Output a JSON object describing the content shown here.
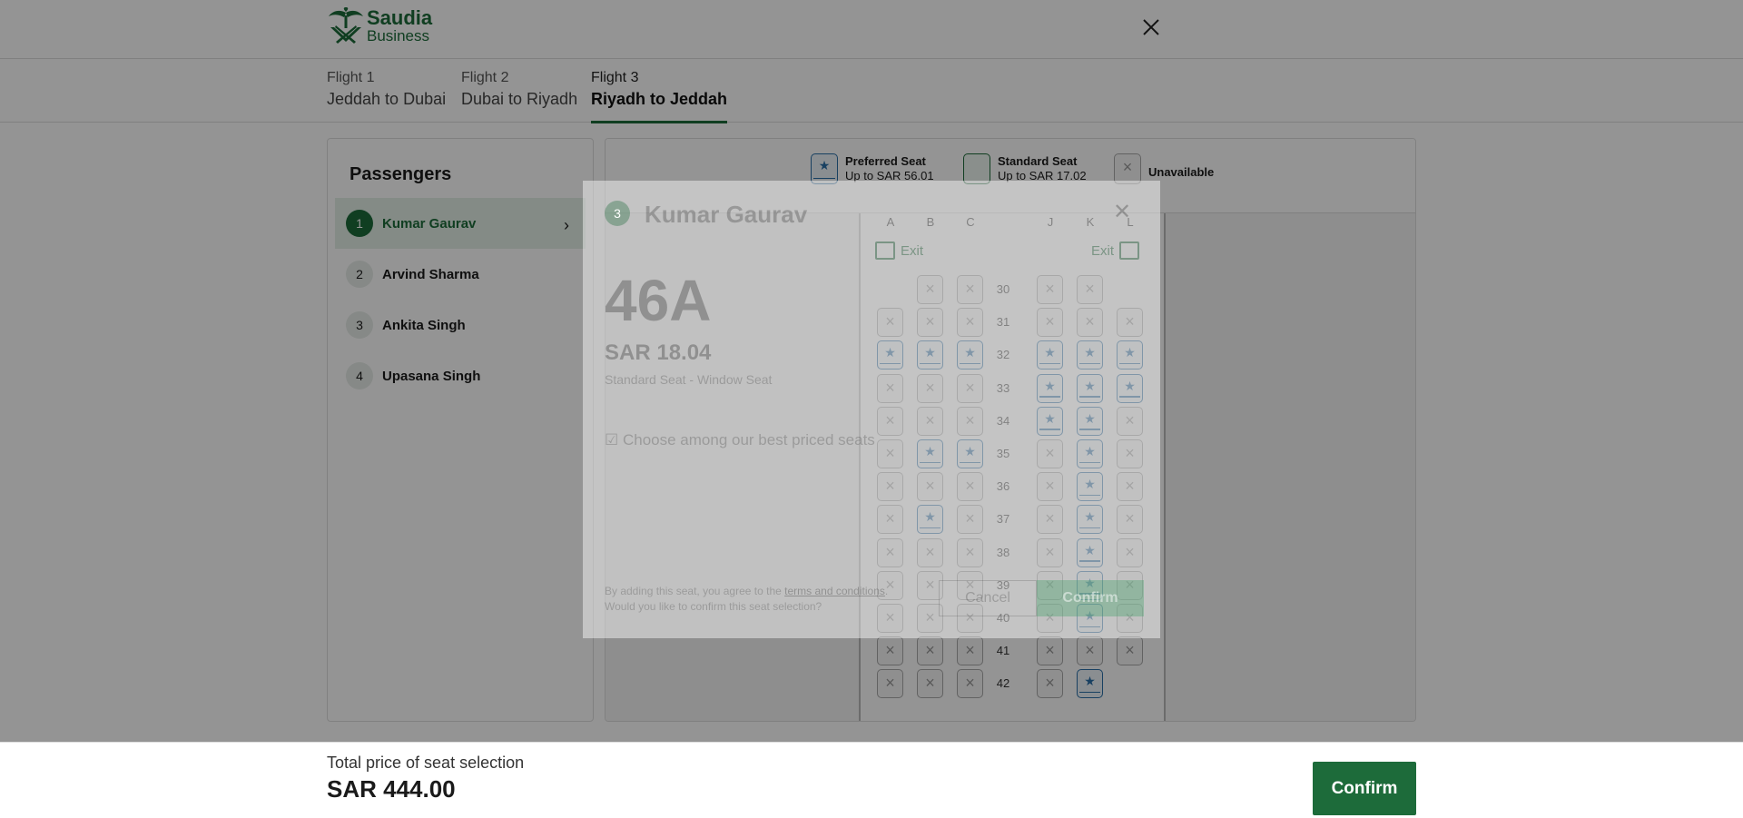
{
  "header": {
    "logo_line1": "Saudia",
    "logo_line2": "Business"
  },
  "tabs": [
    {
      "label": "Flight 1",
      "route": "Jeddah to Dubai"
    },
    {
      "label": "Flight 2",
      "route": "Dubai to Riyadh"
    },
    {
      "label": "Flight 3",
      "route": "Riyadh to Jeddah"
    }
  ],
  "passengers": {
    "title": "Passengers",
    "items": [
      {
        "num": "1",
        "name": "Kumar Gaurav"
      },
      {
        "num": "2",
        "name": "Arvind Sharma"
      },
      {
        "num": "3",
        "name": "Ankita Singh"
      },
      {
        "num": "4",
        "name": "Upasana Singh"
      }
    ]
  },
  "legend": {
    "preferred": {
      "title": "Preferred Seat",
      "price": "Up to SAR 56.01"
    },
    "standard": {
      "title": "Standard Seat",
      "price": "Up to SAR 17.02"
    },
    "unavailable": {
      "title": "Unavailable"
    }
  },
  "seat_map": {
    "columns": [
      "A",
      "B",
      "C",
      "J",
      "K",
      "L"
    ],
    "exit_label": "Exit",
    "rows": [
      "30",
      "31",
      "32",
      "33",
      "34",
      "35",
      "36",
      "37",
      "38",
      "39",
      "40",
      "41",
      "42"
    ]
  },
  "modal": {
    "num": "3",
    "name": "Kumar Gaurav",
    "seat": "46A",
    "price": "SAR 18.04",
    "type": "Standard Seat - Window Seat",
    "choose": "Choose among our best  priced seats",
    "terms_prefix": "By adding this seat, you agree to the ",
    "terms_link": "terms and conditions",
    "terms_suffix": ".",
    "terms_line2": "Would you like to confirm this seat selection?",
    "cancel": "Cancel",
    "confirm": "Confirm"
  },
  "footer": {
    "label": "Total price of seat selection",
    "amount": "SAR 444.00",
    "confirm": "Confirm"
  },
  "colors": {
    "brand": "#1d6b3a",
    "preferred": "#2a6fa8"
  }
}
